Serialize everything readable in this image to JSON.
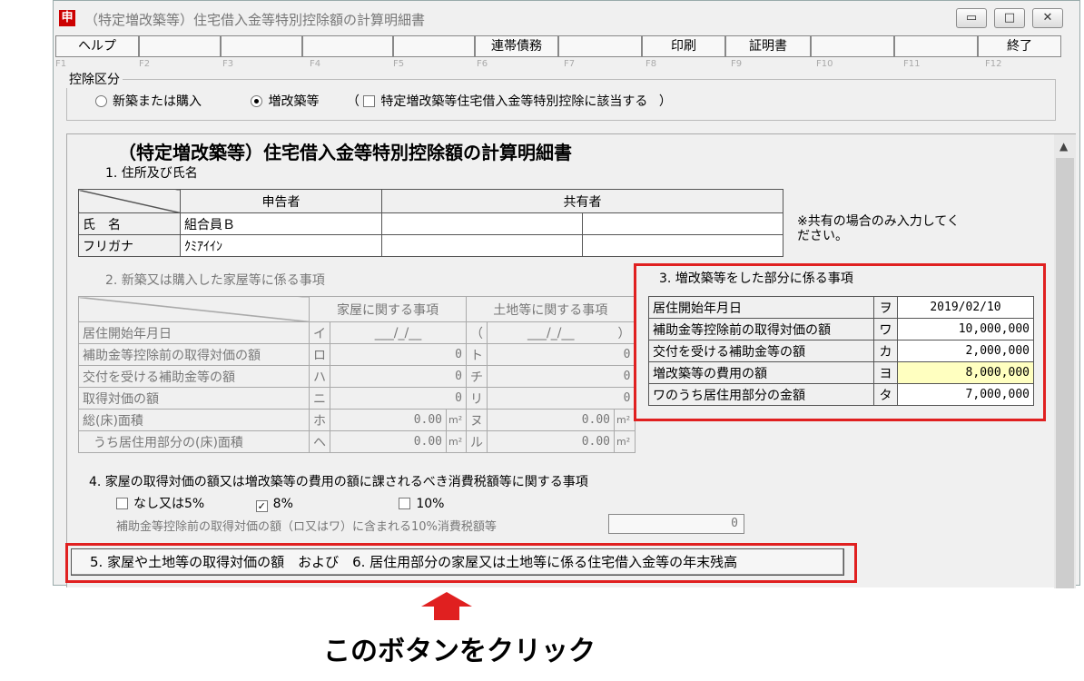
{
  "window": {
    "title": "（特定増改築等）住宅借入金等特別控除額の計算明細書",
    "icon": "申",
    "controls": [
      "▭",
      "□",
      "✕"
    ]
  },
  "fkeys": {
    "labels": [
      "ヘルプ",
      "",
      "",
      "",
      "",
      "連帯債務",
      "",
      "印刷",
      "証明書",
      "",
      "",
      "終了"
    ],
    "numbers": [
      "F1",
      "F2",
      "F3",
      "F4",
      "F5",
      "F6",
      "F7",
      "F8",
      "F9",
      "F10",
      "F11",
      "F12"
    ]
  },
  "deduction": {
    "group_label": "控除区分",
    "opt_new": "新築または購入",
    "opt_reno": "増改築等",
    "paren_open": "（",
    "special_label": "特定増改築等住宅借入金等特別控除に該当する",
    "paren_close": "）"
  },
  "doc": {
    "heading": "（特定増改築等）住宅借入金等特別控除額の計算明細書",
    "sec1": "1. 住所及び氏名",
    "sec1_table": {
      "h_declarant": "申告者",
      "h_coowner": "共有者",
      "name_label": "氏　名",
      "name_value": "組合員Ｂ",
      "kana_label": "フリガナ",
      "kana_value": "ｸﾐｱｲｲﾝ"
    },
    "note": "※共有の場合のみ入力してください。",
    "sec2": "2. 新築又は購入した家屋等に係る事項",
    "sec2_table": {
      "h_house": "家屋に関する事項",
      "h_land": "土地等に関する事項",
      "rows": [
        {
          "label": "居住開始年月日",
          "k1": "イ",
          "v1": "___/_/__",
          "k2": "（",
          "v2": "___/_/__",
          "k3": "）"
        },
        {
          "label": "補助金等控除前の取得対価の額",
          "k1": "ロ",
          "v1": "0",
          "k2": "ト",
          "v2": "0"
        },
        {
          "label": "交付を受ける補助金等の額",
          "k1": "ハ",
          "v1": "0",
          "k2": "チ",
          "v2": "0"
        },
        {
          "label": "取得対価の額",
          "k1": "ニ",
          "v1": "0",
          "k2": "リ",
          "v2": "0"
        },
        {
          "label": "総(床)面積",
          "k1": "ホ",
          "v1": "0.00",
          "u1": "m²",
          "k2": "ヌ",
          "v2": "0.00",
          "u2": "m²"
        },
        {
          "label": "うち居住用部分の(床)面積",
          "k1": "ヘ",
          "v1": "0.00",
          "u1": "m²",
          "k2": "ル",
          "v2": "0.00",
          "u2": "m²"
        }
      ]
    },
    "sec3": "3. 増改築等をした部分に係る事項",
    "sec3_rows": [
      {
        "label": "居住開始年月日",
        "k": "ヲ",
        "v": "2019/02/10"
      },
      {
        "label": "補助金等控除前の取得対価の額",
        "k": "ワ",
        "v": "10,000,000"
      },
      {
        "label": "交付を受ける補助金等の額",
        "k": "カ",
        "v": "2,000,000"
      },
      {
        "label": "増改築等の費用の額",
        "k": "ヨ",
        "v": "8,000,000"
      },
      {
        "label": "ワのうち居住用部分の金額",
        "k": "タ",
        "v": "7,000,000"
      }
    ],
    "sec4": "4. 家屋の取得対価の額又は増改築等の費用の額に課されるべき消費税額等に関する事項",
    "tax_none": "なし又は5%",
    "tax_8": "8%",
    "tax_10": "10%",
    "tax_included_label": "補助金等控除前の取得対価の額（ロ又はワ）に含まれる10%消費税額等",
    "tax_included_value": "0",
    "next_button": "5. 家屋や土地等の取得対価の額　および　6. 居住用部分の家屋又は土地等に係る住宅借入金等の年末残高"
  },
  "callout": "このボタンをクリック",
  "colors": {
    "highlight": "#e02020",
    "yellow_cell": "#ffffc0"
  }
}
